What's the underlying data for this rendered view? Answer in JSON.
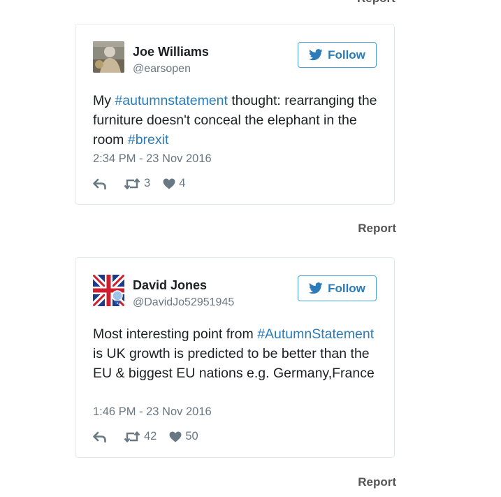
{
  "tweets": [
    {
      "name": "Joe Williams",
      "handle": "@earsopen",
      "follow_label": "Follow",
      "text_parts": {
        "p1": "My ",
        "p2": "#autumnstatement",
        "p3": " thought: rearranging the furniture doesn't conceal the elephant in the room ",
        "p4": "#brexit"
      },
      "timestamp": "2:34 PM - 23 Nov 2016",
      "retweets": "3",
      "likes": "4",
      "report_label": "Report"
    },
    {
      "name": "David Jones",
      "handle": "@DavidJo52951945",
      "follow_label": "Follow",
      "text_parts": {
        "p1": "Most interesting point from ",
        "p2": "#AutumnStatement",
        "p3": " is UK growth is predicted to be better than the EU & biggest EU nations e.g. Germany,France"
      },
      "timestamp": "1:46 PM - 23 Nov 2016",
      "retweets": "42",
      "likes": "50",
      "report_label": "Report"
    }
  ],
  "top_peek": {
    "label": "Report"
  },
  "colors": {
    "link": "#2b7bb9",
    "muted": "#697882",
    "border": "#e1e8ed",
    "follow_border": "#4aa1d9"
  },
  "icons": {
    "follow": "twitter-bird-icon",
    "reply": "reply-arrow-icon",
    "retweet": "retweet-icon",
    "like": "heart-icon"
  }
}
